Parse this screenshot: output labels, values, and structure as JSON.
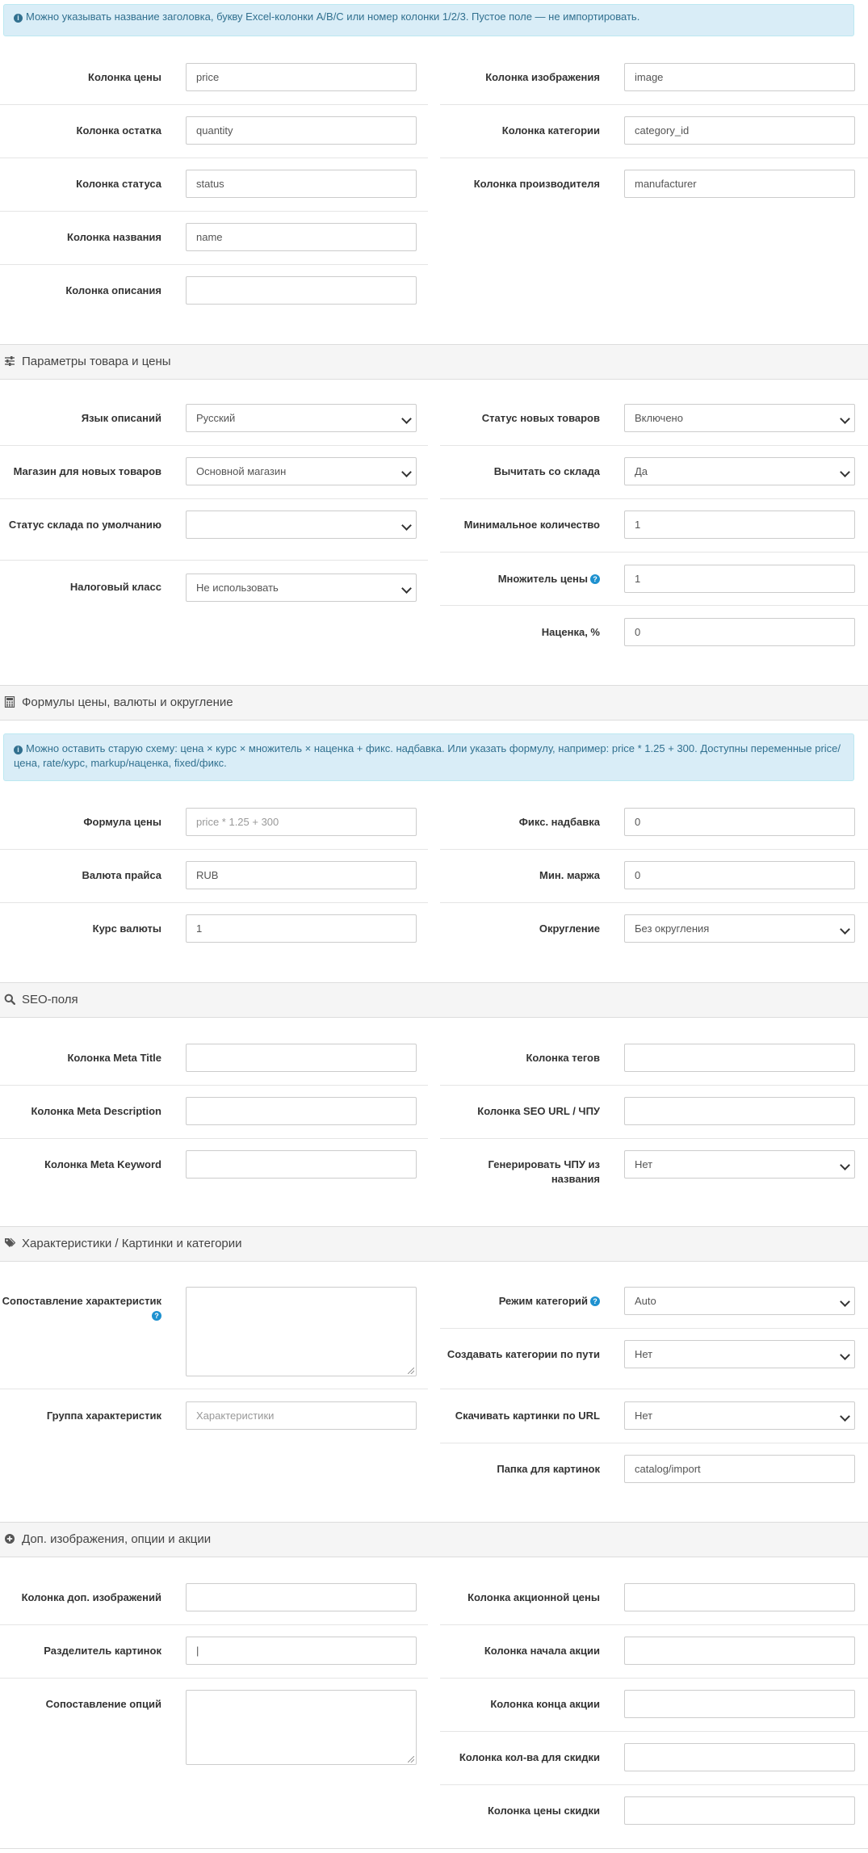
{
  "top_alert": "Можно указывать название заголовка, букву Excel-колонки A/B/C или номер колонки 1/2/3. Пустое поле — не импортировать.",
  "columns": {
    "price_label": "Колонка цены",
    "price_value": "price",
    "image_label": "Колонка изображения",
    "image_value": "image",
    "quantity_label": "Колонка остатка",
    "quantity_value": "quantity",
    "category_label": "Колонка категории",
    "category_value": "category_id",
    "status_label": "Колонка статуса",
    "status_value": "status",
    "manufacturer_label": "Колонка производителя",
    "manufacturer_value": "manufacturer",
    "name_label": "Колонка названия",
    "name_value": "name",
    "description_label": "Колонка описания",
    "description_value": ""
  },
  "product_params": {
    "title": "Параметры товара и цены",
    "language_label": "Язык описаний",
    "language_value": "Русский",
    "new_status_label": "Статус новых товаров",
    "new_status_value": "Включено",
    "store_label": "Магазин для новых товаров",
    "store_value": "Основной магазин",
    "subtract_label": "Вычитать со склада",
    "subtract_value": "Да",
    "stock_status_label": "Статус склада по умолчанию",
    "stock_status_value": "",
    "minimum_label": "Минимальное количество",
    "minimum_value": "1",
    "tax_label": "Налоговый класс",
    "tax_value": "Не использовать",
    "multiplier_label": "Множитель цены",
    "multiplier_value": "1",
    "markup_label": "Наценка, %",
    "markup_value": "0"
  },
  "formulas": {
    "title": "Формулы цены, валюты и округление",
    "alert": "Можно оставить старую схему: цена × курс × множитель × наценка + фикс. надбавка. Или указать формулу, например: price * 1.25 + 300. Доступны переменные price/цена, rate/курс, markup/наценка, fixed/фикс.",
    "formula_label": "Формула цены",
    "formula_placeholder": "price * 1.25 + 300",
    "fixed_label": "Фикс. надбавка",
    "fixed_value": "0",
    "currency_label": "Валюта прайса",
    "currency_value": "RUB",
    "margin_label": "Мин. маржа",
    "margin_value": "0",
    "rate_label": "Курс валюты",
    "rate_value": "1",
    "rounding_label": "Округление",
    "rounding_value": "Без округления"
  },
  "seo": {
    "title": "SEO-поля",
    "meta_title_label": "Колонка Meta Title",
    "meta_title_value": "",
    "tags_label": "Колонка тегов",
    "tags_value": "",
    "meta_desc_label": "Колонка Meta Description",
    "meta_desc_value": "",
    "seo_url_label": "Колонка SEO URL / ЧПУ",
    "seo_url_value": "",
    "meta_kw_label": "Колонка Meta Keyword",
    "meta_kw_value": "",
    "gen_url_label": "Генерировать ЧПУ из названия",
    "gen_url_value": "Нет"
  },
  "attributes": {
    "title": "Характеристики / Картинки и категории",
    "attr_map_label": "Сопоставление характеристик",
    "category_mode_label": "Режим категорий",
    "category_mode_value": "Auto",
    "create_cat_label": "Создавать категории по пути",
    "create_cat_value": "Нет",
    "attr_group_label": "Группа характеристик",
    "attr_group_placeholder": "Характеристики",
    "download_images_label": "Скачивать картинки по URL",
    "download_images_value": "Нет",
    "image_folder_label": "Папка для картинок",
    "image_folder_value": "catalog/import"
  },
  "extras": {
    "title": "Доп. изображения, опции и акции",
    "extra_images_label": "Колонка доп. изображений",
    "extra_images_value": "",
    "special_price_label": "Колонка акционной цены",
    "special_price_value": "",
    "image_sep_label": "Разделитель картинок",
    "image_sep_value": "|",
    "special_start_label": "Колонка начала акции",
    "special_start_value": "",
    "options_map_label": "Сопоставление опций",
    "special_end_label": "Колонка конца акции",
    "special_end_value": "",
    "discount_qty_label": "Колонка кол-ва для скидки",
    "discount_qty_value": "",
    "discount_price_label": "Колонка цены скидки",
    "discount_price_value": ""
  },
  "icons": {
    "info": "info-circle-icon",
    "sliders": "sliders-icon",
    "calculator": "calculator-icon",
    "search": "search-icon",
    "tags": "tags-icon",
    "plus_circle": "plus-circle-icon",
    "help": "question-circle-icon"
  }
}
